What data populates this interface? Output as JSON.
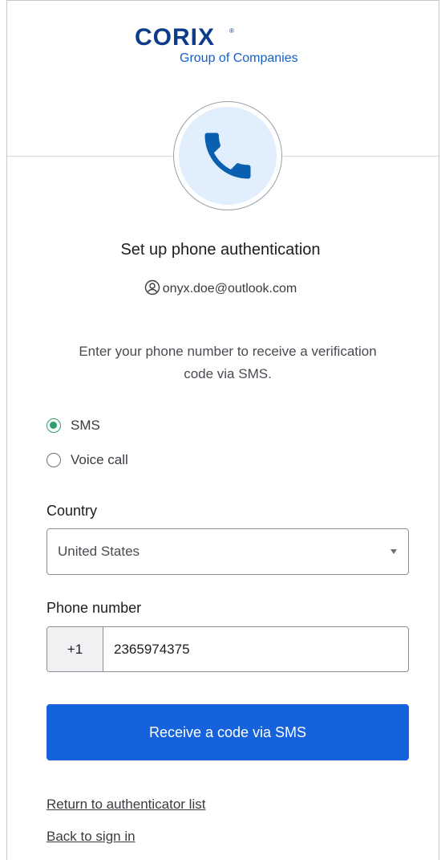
{
  "brand": {
    "wordmark": "CORIX",
    "trademark": "®",
    "tagline": "Group of Companies",
    "colors": {
      "primary": "#0c3b8a",
      "secondary": "#1560c4"
    }
  },
  "header": {
    "icon": "phone-icon",
    "icon_color": "#0b5fb0",
    "icon_bg": "#e1effd"
  },
  "title": "Set up phone authentication",
  "user": {
    "icon": "user-circle-icon",
    "email": "onyx.doe@outlook.com"
  },
  "instructions": "Enter your phone number to receive a verification code via SMS.",
  "method_options": [
    {
      "label": "SMS",
      "checked": true
    },
    {
      "label": "Voice call",
      "checked": false
    }
  ],
  "country": {
    "label": "Country",
    "value": "United States"
  },
  "phone": {
    "label": "Phone number",
    "prefix": "+1",
    "value": "2365974375"
  },
  "submit_label": "Receive a code via SMS",
  "links": {
    "return_list": "Return to authenticator list",
    "back_signin": "Back to sign in"
  },
  "colors": {
    "button": "#1662dd",
    "radio_checked": "#2f9e6b"
  }
}
